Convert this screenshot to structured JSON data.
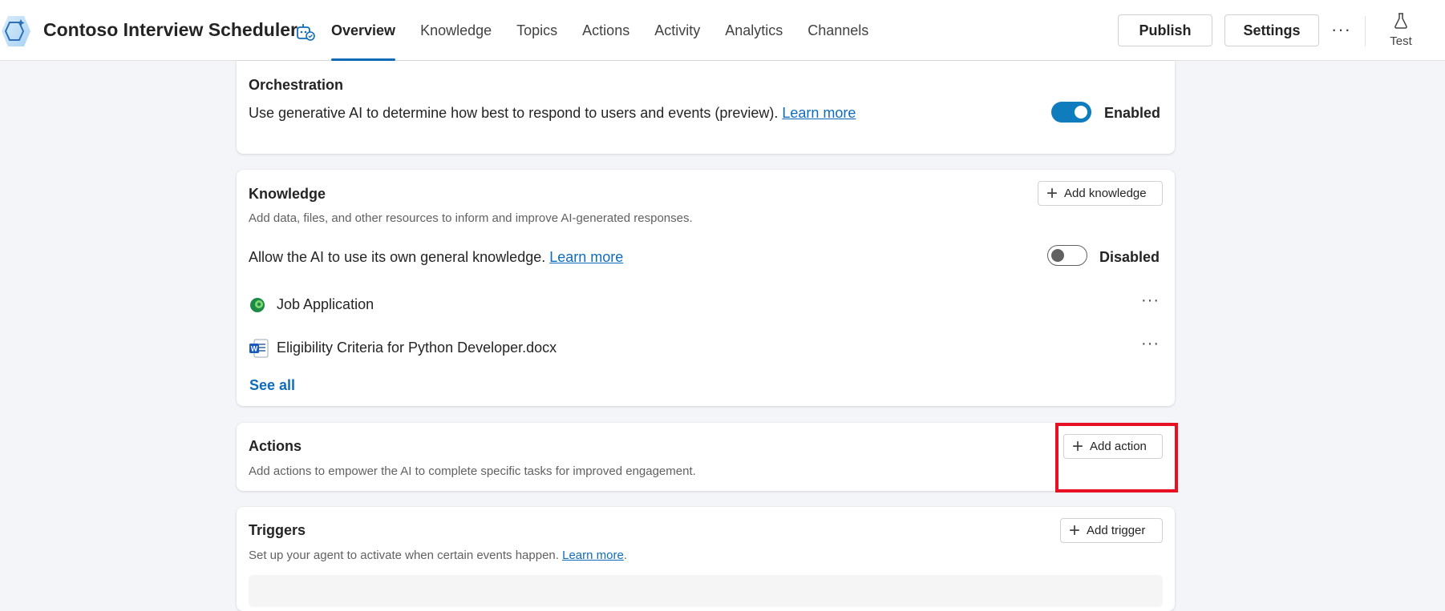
{
  "app": {
    "title": "Contoso Interview Scheduler",
    "logo_icon": "copilot-hexagon-icon",
    "agent_icon": "agent-bot-icon"
  },
  "tabs": [
    {
      "label": "Overview",
      "active": true
    },
    {
      "label": "Knowledge",
      "active": false
    },
    {
      "label": "Topics",
      "active": false
    },
    {
      "label": "Actions",
      "active": false
    },
    {
      "label": "Activity",
      "active": false
    },
    {
      "label": "Analytics",
      "active": false
    },
    {
      "label": "Channels",
      "active": false
    }
  ],
  "toolbar": {
    "publish_label": "Publish",
    "settings_label": "Settings",
    "more_label": "···",
    "test_label": "Test"
  },
  "orchestration": {
    "title": "Orchestration",
    "description": "Use generative AI to determine how best to respond to users and events (preview).",
    "learn_more": "Learn more",
    "toggle_state": "on",
    "toggle_label": "Enabled"
  },
  "knowledge": {
    "title": "Knowledge",
    "description": "Add data, files, and other resources to inform and improve AI-generated responses.",
    "add_label": "Add knowledge",
    "general_text": "Allow the AI to use its own general knowledge.",
    "learn_more": "Learn more",
    "toggle_state": "off",
    "toggle_label": "Disabled",
    "items": [
      {
        "label": "Job Application",
        "icon": "dataverse-icon",
        "more": "···"
      },
      {
        "label": "Eligibility Criteria for Python Developer.docx",
        "icon": "word-doc-icon",
        "more": "···"
      }
    ],
    "see_all": "See all"
  },
  "actions": {
    "title": "Actions",
    "description": "Add actions to empower the AI to complete specific tasks for improved engagement.",
    "add_label": "Add action"
  },
  "triggers": {
    "title": "Triggers",
    "description": "Set up your agent to activate when certain events happen.",
    "learn_more": "Learn more",
    "period": ".",
    "add_label": "Add trigger"
  },
  "colors": {
    "accent": "#0f6cbd",
    "toggle_on": "#0f7cbd",
    "highlight": "#e81123"
  }
}
